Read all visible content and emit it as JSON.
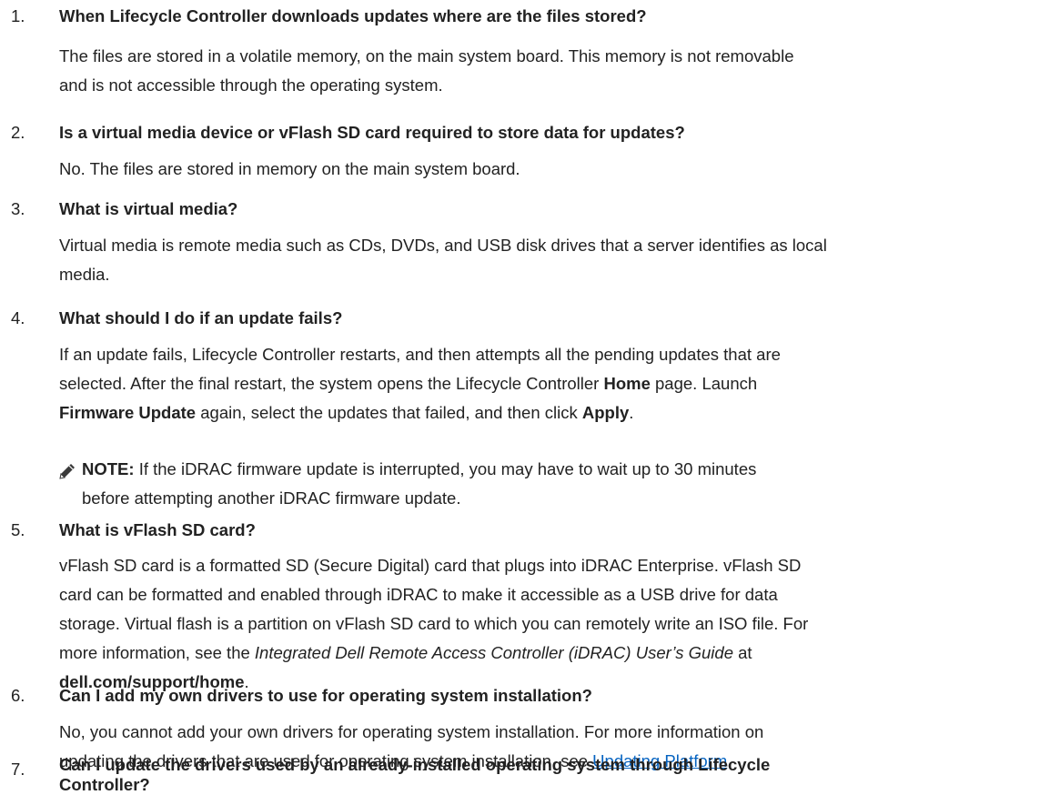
{
  "faq": [
    {
      "num": "1.",
      "question": "When Lifecycle Controller downloads updates where are the files stored?",
      "answer_line1": "The files are stored in a volatile memory, on the main system board. This memory is not removable",
      "answer_line2": "and is not accessible through the operating system."
    },
    {
      "num": "2.",
      "question": "Is a virtual media device or vFlash SD card required to store data for updates?",
      "answer": "No. The files are stored in memory on the main system board."
    },
    {
      "num": "3.",
      "question": "What is virtual media?",
      "answer_line1": "Virtual media is remote media such as CDs, DVDs, and USB disk drives that a server identifies as local",
      "answer_line2": "media."
    },
    {
      "num": "4.",
      "question": "What should I do if an update fails?",
      "answer_line1": "If an update fails, Lifecycle Controller restarts, and then attempts all the pending updates that are",
      "answer_line2_a": "selected. After the final restart, the system opens the Lifecycle Controller ",
      "answer_line2_b": "Home",
      "answer_line2_c": " page. Launch",
      "answer_line3_a": "Firmware Update",
      "answer_line3_b": " again, select the updates that failed, and then click ",
      "answer_line3_c": "Apply",
      "answer_line3_d": ".",
      "note_label": "NOTE:",
      "note_line1": " If the iDRAC firmware update is interrupted, you may have to wait up to 30 minutes",
      "note_line2": "before attempting another iDRAC firmware update.",
      "note_icon": "pencil-note-icon"
    },
    {
      "num": "5.",
      "question": "What is vFlash SD card?",
      "answer_line1": "vFlash SD card is a formatted SD (Secure Digital) card that plugs into iDRAC Enterprise. vFlash SD",
      "answer_line2": "card can be formatted and enabled through iDRAC to make it accessible as a USB drive for data",
      "answer_line3": "storage. Virtual flash is a partition on vFlash SD card to which you can remotely write an ISO file. For",
      "answer_line4_a": "more information, see the ",
      "answer_line4_b": "Integrated Dell Remote Access Controller (iDRAC) User’s Guide",
      "answer_line4_c": " at",
      "answer_line5_a": "dell.com/support/home",
      "answer_line5_b": "."
    },
    {
      "num": "6.",
      "question": "Can I add my own drivers to use for operating system installation?",
      "answer_line1": "No, you cannot add your own drivers for operating system installation. For more information on",
      "answer_line2_a": "updating the drivers that are used for operating system installation, see ",
      "answer_line2_link": "Updating Platform",
      "answer_line2_b": "."
    },
    {
      "num": "7.",
      "question_line1": "Can I update the drivers used by an already-installed operating system through Lifecycle",
      "question_line2": "Controller?"
    }
  ]
}
